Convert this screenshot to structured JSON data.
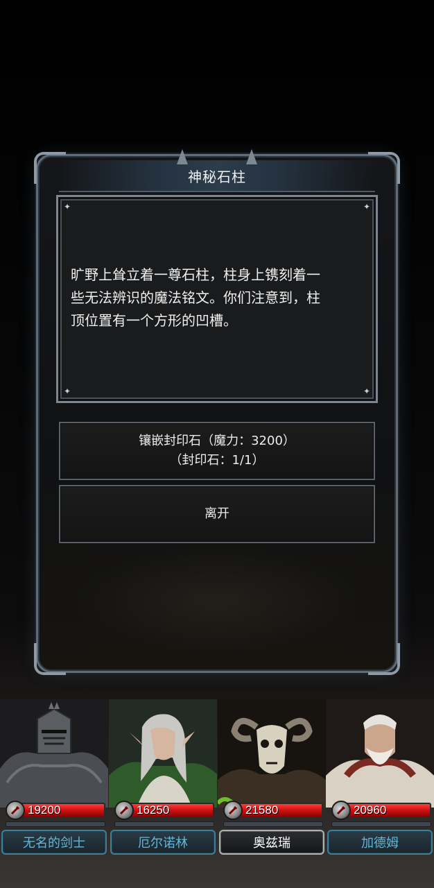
{
  "dialog": {
    "title": "神秘石柱",
    "story_lines": [
      "旷野上耸立着一尊石柱，柱身上镌刻着一",
      "些无法辨识的魔法铭文。你们注意到，柱",
      "顶位置有一个方形的凹槽。"
    ],
    "options": [
      {
        "line1": "镶嵌封印石（魔力：3200）",
        "line2": "（封印石：1/1）"
      },
      {
        "line1": "离开"
      }
    ]
  },
  "party": [
    {
      "name": "无名的剑士",
      "hp": "19200",
      "portrait": "armored-knight",
      "active": false
    },
    {
      "name": "厄尔诺林",
      "hp": "16250",
      "portrait": "elf-ranger",
      "active": false
    },
    {
      "name": "奥兹瑞",
      "hp": "21580",
      "portrait": "goat-skull-shaman",
      "active": true
    },
    {
      "name": "加德姆",
      "hp": "20960",
      "portrait": "old-priest",
      "active": false
    }
  ],
  "colors": {
    "hp": "#c80f0f",
    "name_teal": "#5fb9d8",
    "frame": "#5f6b76"
  }
}
